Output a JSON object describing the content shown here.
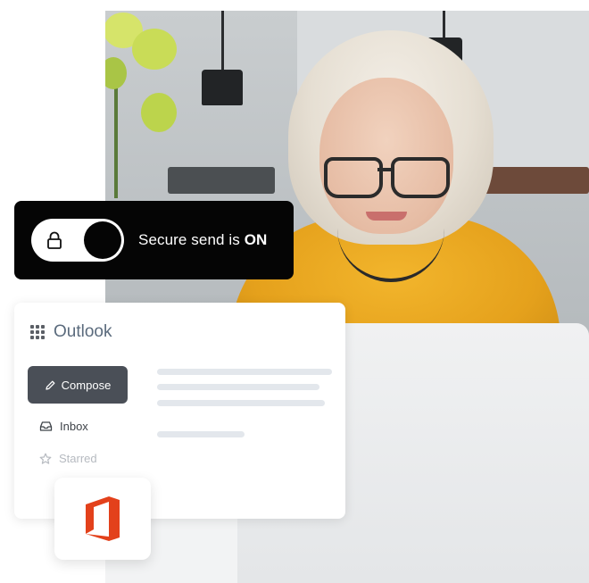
{
  "secure_send": {
    "prefix": "Secure send is",
    "status": "ON",
    "toggle_on": true
  },
  "outlook": {
    "app_name": "Outlook",
    "compose_label": "Compose",
    "nav": [
      {
        "label": "Inbox",
        "icon": "inbox-icon",
        "active": true
      },
      {
        "label": "Starred",
        "icon": "star-icon",
        "active": false
      }
    ]
  },
  "icons": {
    "apps": "grid-icon",
    "lock": "lock-icon",
    "compose": "pencil-icon",
    "office": "office-logo-icon"
  },
  "colors": {
    "pill_bg": "#050505",
    "compose_bg": "#4a4f57",
    "app_name": "#5b6b7d",
    "office_red": "#e3411b"
  }
}
